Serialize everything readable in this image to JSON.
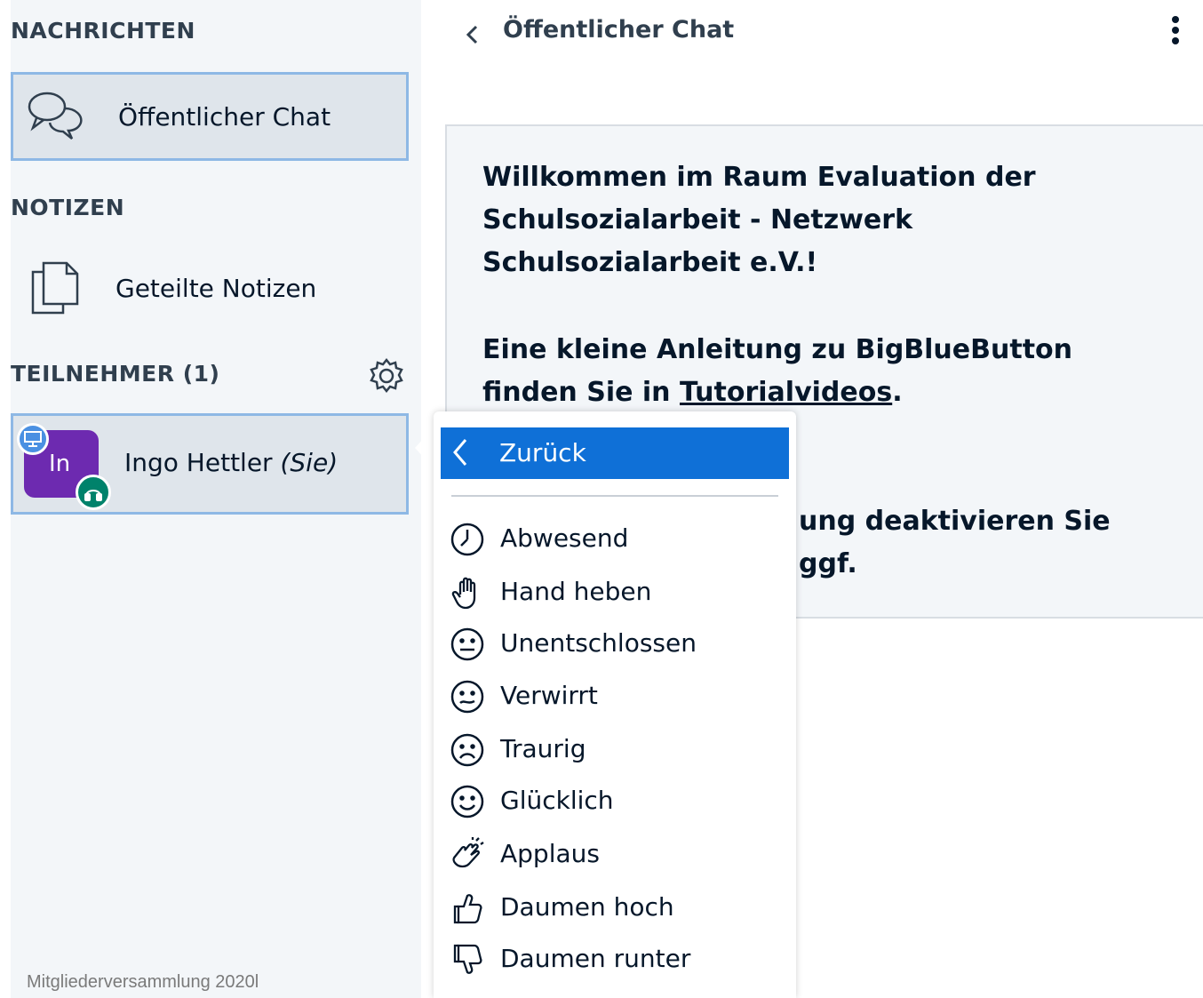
{
  "sidebar": {
    "messages_title": "NACHRICHTEN",
    "public_chat_label": "Öffentlicher Chat",
    "notes_title": "NOTIZEN",
    "shared_notes_label": "Geteilte Notizen",
    "participants_title": "TEILNEHMER (1)",
    "user": {
      "initials": "In",
      "name": "Ingo Hettler",
      "self_marker": "(Sie)",
      "avatar_color": "#6d2ab0"
    }
  },
  "chat": {
    "title": "Öffentlicher Chat",
    "welcome_line1_prefix": "Willkommen im Raum Evaluation der Schulsozialarbeit - Netzwerk Schulsozialarbeit e.V.!",
    "welcome_line2_prefix": "Eine kleine Anleitung zu BigBlueButton finden Sie in ",
    "welcome_line2_link": "Tutorialvideos",
    "welcome_line2_suffix": ".",
    "welcome_line3_visible": "ung deaktivieren Sie ggf."
  },
  "status_menu": {
    "back_label": "Zurück",
    "items": [
      {
        "label": "Abwesend",
        "icon": "clock-icon"
      },
      {
        "label": "Hand heben",
        "icon": "hand-icon"
      },
      {
        "label": "Unentschlossen",
        "icon": "neutral-face-icon"
      },
      {
        "label": "Verwirrt",
        "icon": "confused-face-icon"
      },
      {
        "label": "Traurig",
        "icon": "sad-face-icon"
      },
      {
        "label": "Glücklich",
        "icon": "happy-face-icon"
      },
      {
        "label": "Applaus",
        "icon": "applause-icon"
      },
      {
        "label": "Daumen hoch",
        "icon": "thumbs-up-icon"
      },
      {
        "label": "Daumen runter",
        "icon": "thumbs-down-icon"
      }
    ]
  },
  "footer": "Mitgliederversammlung 2020l",
  "colors": {
    "accent": "#0f70d7",
    "selected_border": "#8eb8e5",
    "sidebar_bg": "#f3f6f9",
    "audio_badge": "#00826b"
  }
}
